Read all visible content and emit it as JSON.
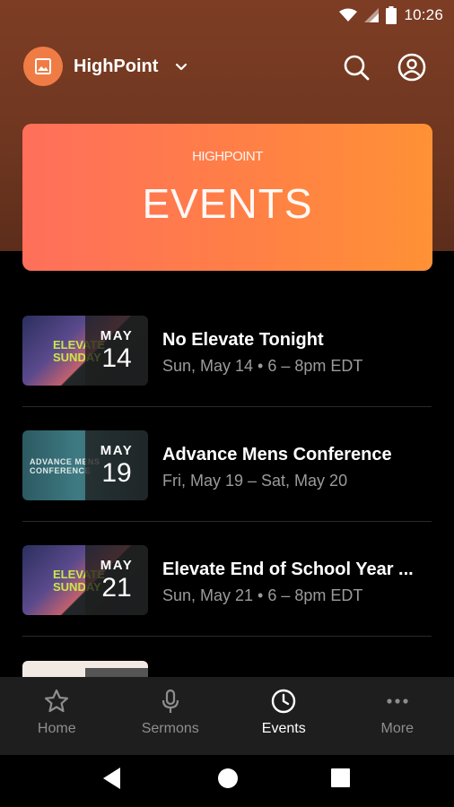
{
  "status_bar": {
    "time": "10:26"
  },
  "header": {
    "app_name": "HighPoint",
    "icons": {
      "logo": "image-icon",
      "chevron": "chevron-down-icon",
      "search": "search-icon",
      "profile": "profile-icon"
    }
  },
  "banner": {
    "kicker": "HIGHPOINT",
    "title": "EVENTS"
  },
  "events": [
    {
      "month": "MAY",
      "day": "14",
      "title": "No Elevate Tonight",
      "subtitle": "Sun, May 14 • 6 – 8pm EDT",
      "thumb_text": "ELEVATE SUNDAY"
    },
    {
      "month": "MAY",
      "day": "19",
      "title": "Advance Mens Conference",
      "subtitle": "Fri, May 19 – Sat, May 20",
      "thumb_text": "ADVANCE MENS CONFERENCE"
    },
    {
      "month": "MAY",
      "day": "21",
      "title": "Elevate End of School Year ...",
      "subtitle": "Sun, May 21 • 6 – 8pm EDT",
      "thumb_text": "ELEVATE SUNDAY"
    }
  ],
  "nav": {
    "items": [
      {
        "label": "Home",
        "icon": "star-icon"
      },
      {
        "label": "Sermons",
        "icon": "microphone-icon"
      },
      {
        "label": "Events",
        "icon": "clock-icon"
      },
      {
        "label": "More",
        "icon": "more-dots-icon"
      }
    ],
    "active": "Events",
    "active_color": "#ffffff",
    "inactive_color": "#8e8e8e"
  },
  "colors": {
    "brand": "#f07c45",
    "header_bg": "#7d3d24",
    "banner_start": "#ff6f5b",
    "banner_end": "#ff9135"
  }
}
